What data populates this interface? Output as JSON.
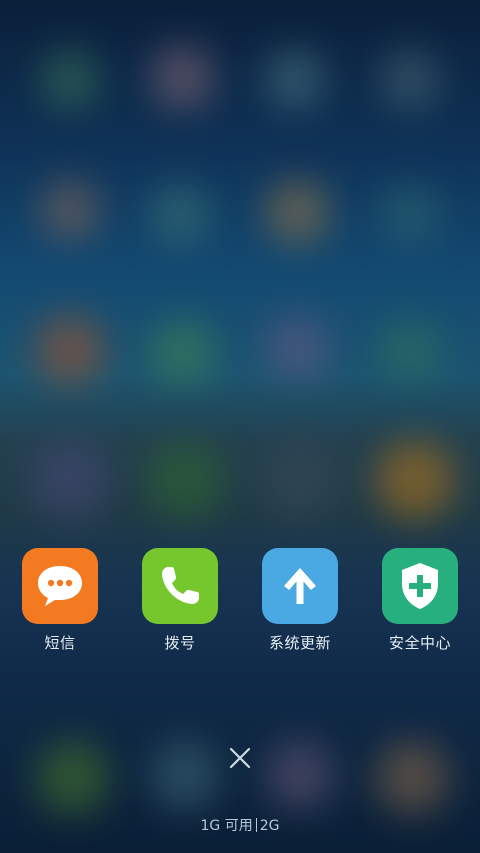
{
  "dock": {
    "apps": [
      {
        "label": "短信",
        "icon": "message-bubble-icon",
        "color": "#f47a22"
      },
      {
        "label": "拨号",
        "icon": "phone-icon",
        "color": "#75c72d"
      },
      {
        "label": "系统更新",
        "icon": "arrow-up-icon",
        "color": "#4aa8e2"
      },
      {
        "label": "安全中心",
        "icon": "shield-plus-icon",
        "color": "#27b07e"
      }
    ]
  },
  "recents": {
    "close_icon": "close-icon",
    "memory": {
      "available": "1G 可用",
      "total": "2G"
    }
  }
}
